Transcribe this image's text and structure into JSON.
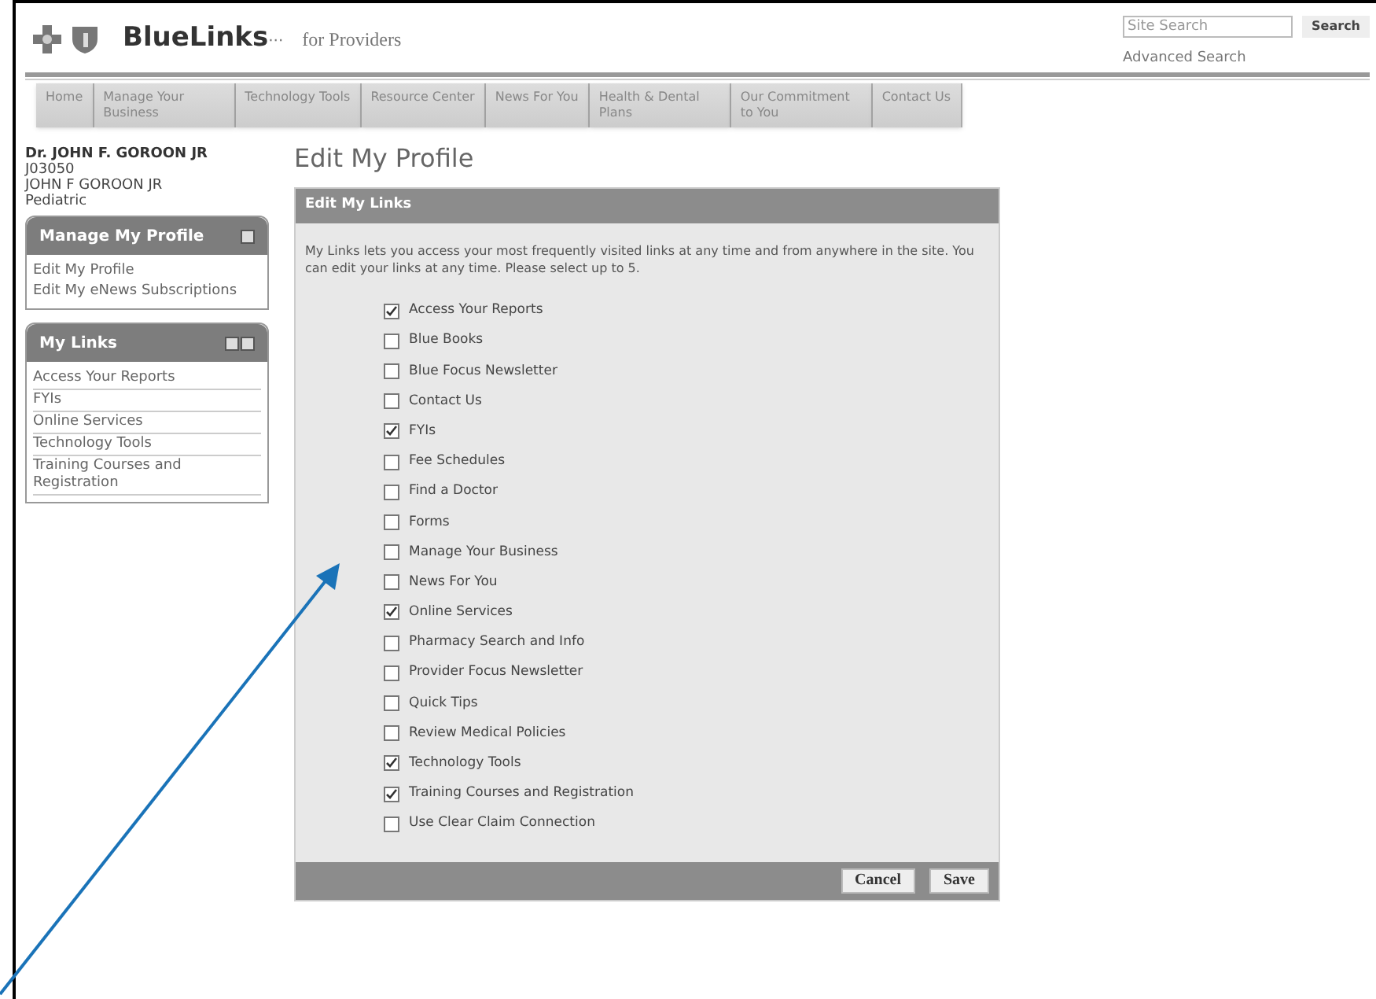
{
  "header": {
    "brand": "BlueLinks",
    "brand_suffix": "···",
    "tagline": "for Providers",
    "search": {
      "placeholder": "Site Search",
      "button": "Search"
    },
    "advanced_search": "Advanced Search"
  },
  "nav": [
    "Home",
    "Manage Your Business",
    "Technology Tools",
    "Resource Center",
    "News For You",
    "Health & Dental Plans",
    "Our Commitment to You",
    "Contact Us"
  ],
  "user": {
    "name": "Dr. JOHN F. GOROON JR",
    "id": "J03050",
    "full_name": "JOHN F GOROON JR",
    "specialty": "Pediatric"
  },
  "manage_profile": {
    "title": "Manage My Profile",
    "links": [
      "Edit My Profile",
      "Edit My eNews Subscriptions"
    ]
  },
  "my_links": {
    "title": "My Links",
    "links": [
      "Access Your Reports",
      "FYIs",
      "Online Services",
      "Technology Tools",
      "Training Courses and Registration"
    ]
  },
  "page_title": "Edit My Profile",
  "panel": {
    "title": "Edit My Links",
    "intro": "My Links lets you access your most frequently visited links at any time and from anywhere in the site. You can edit your links at any time. Please select up to 5.",
    "options": [
      {
        "label": "Access Your Reports",
        "checked": true
      },
      {
        "label": "Blue Books",
        "checked": false
      },
      {
        "label": "Blue Focus Newsletter",
        "checked": false
      },
      {
        "label": "Contact Us",
        "checked": false
      },
      {
        "label": "FYIs",
        "checked": true
      },
      {
        "label": "Fee Schedules",
        "checked": false
      },
      {
        "label": "Find a Doctor",
        "checked": false
      },
      {
        "label": "Forms",
        "checked": false
      },
      {
        "label": "Manage Your Business",
        "checked": false
      },
      {
        "label": "News For You",
        "checked": false
      },
      {
        "label": "Online Services",
        "checked": true
      },
      {
        "label": "Pharmacy Search and Info",
        "checked": false
      },
      {
        "label": "Provider Focus Newsletter",
        "checked": false
      },
      {
        "label": "Quick Tips",
        "checked": false
      },
      {
        "label": "Review Medical Policies",
        "checked": false
      },
      {
        "label": "Technology Tools",
        "checked": true
      },
      {
        "label": "Training Courses and Registration",
        "checked": true
      },
      {
        "label": "Use Clear Claim Connection",
        "checked": false
      }
    ],
    "buttons": [
      "Cancel",
      "Save"
    ]
  }
}
